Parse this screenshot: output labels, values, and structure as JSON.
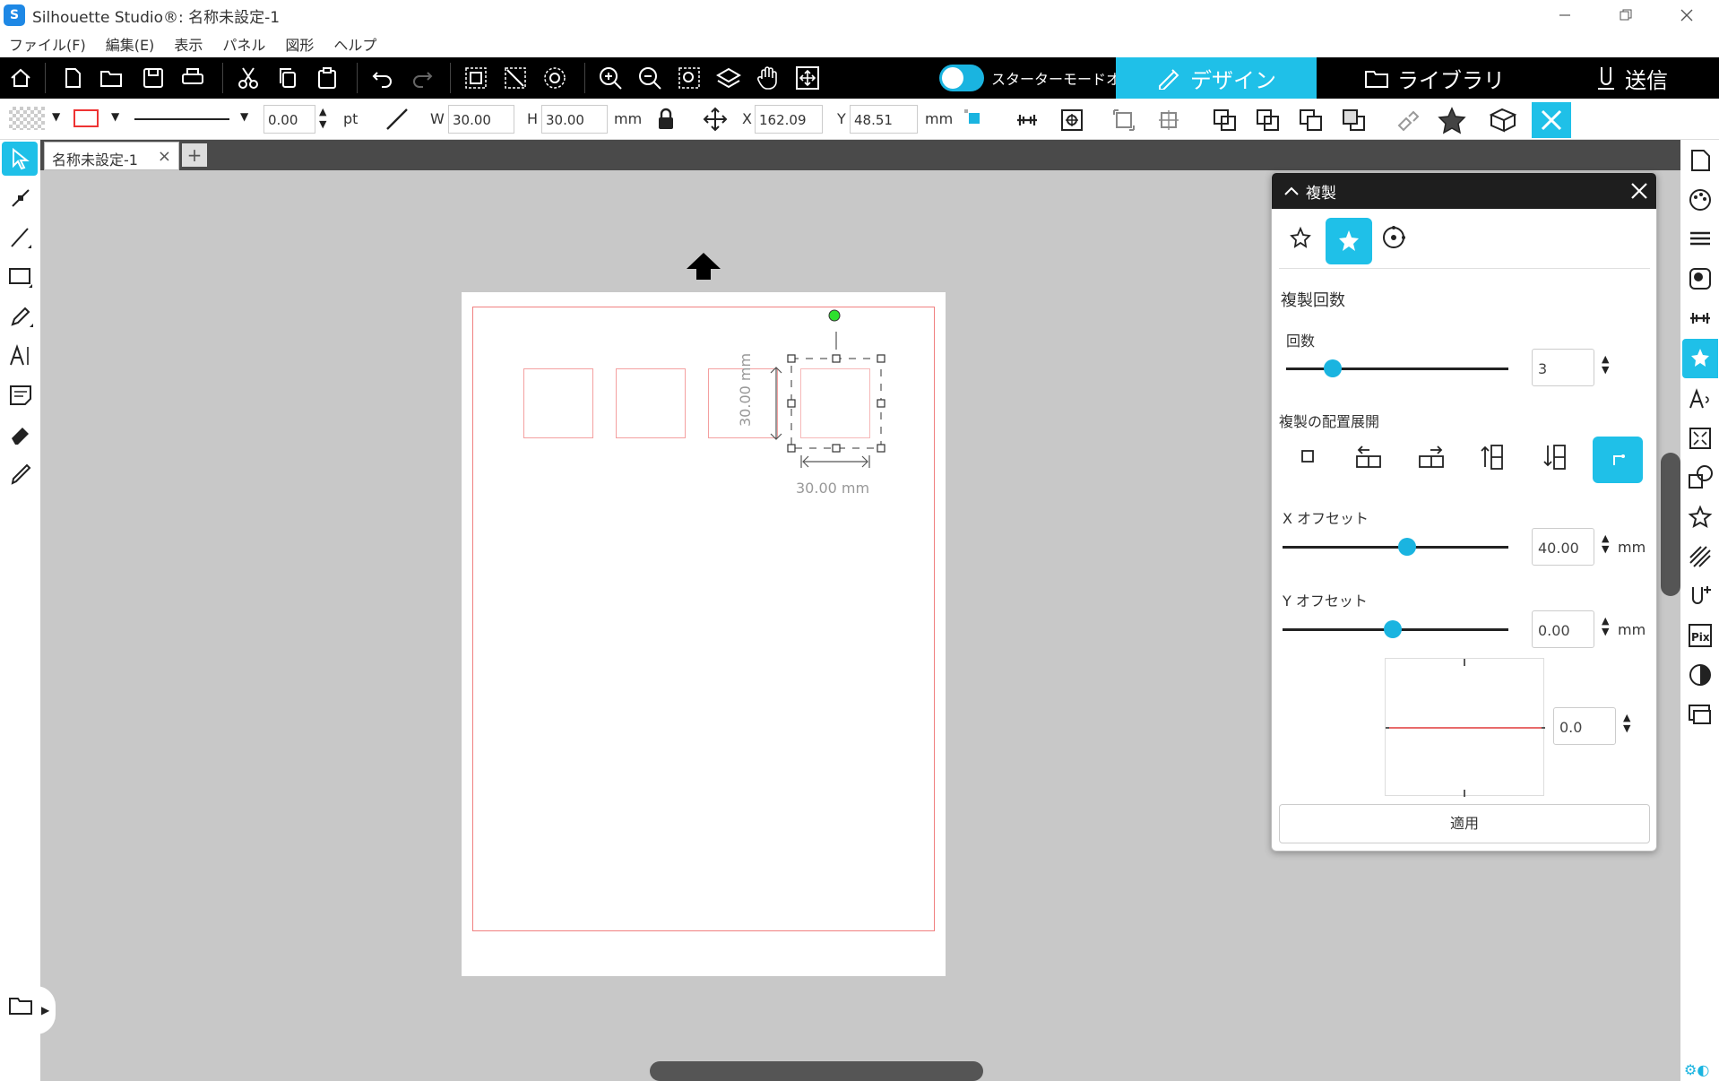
{
  "window": {
    "title": "Silhouette Studio®: 名称未設定-1",
    "app_icon": "S"
  },
  "menu": [
    "ファイル(F)",
    "編集(E)",
    "表示",
    "パネル",
    "図形",
    "ヘルプ"
  ],
  "toolbar": {
    "starter_mode_label": "スターターモードオフ",
    "tabs": {
      "design": "デザイン",
      "library": "ライブラリ",
      "send": "送信"
    }
  },
  "properties": {
    "line_width": "0.00",
    "line_unit": "pt",
    "w_label": "W",
    "w_value": "30.00",
    "h_label": "H",
    "h_value": "30.00",
    "size_unit": "mm",
    "x_label": "X",
    "x_value": "162.09",
    "y_label": "Y",
    "y_value": "48.51",
    "pos_unit": "mm"
  },
  "document": {
    "tab_label": "名称未設定-1",
    "tab_close": "×",
    "add_tab": "+",
    "dim_vertical": "30.00 mm",
    "dim_horizontal": "30.00 mm"
  },
  "panel": {
    "title": "複製",
    "section_title": "複製回数",
    "count_label": "回数",
    "count_value": "3",
    "count_slider": 0.21,
    "layout_label": "複製の配置展開",
    "x_offset_label": "X オフセット",
    "x_offset_value": "40.00",
    "x_offset_slider": 0.55,
    "y_offset_label": "Y オフセット",
    "y_offset_value": "0.00",
    "y_offset_slider": 0.49,
    "unit": "mm",
    "angle_value": "0.0",
    "apply_label": "適用"
  },
  "colors": {
    "accent": "#1fc0e8",
    "cut_line": "#f08080",
    "toolbar_bg": "#000000"
  }
}
